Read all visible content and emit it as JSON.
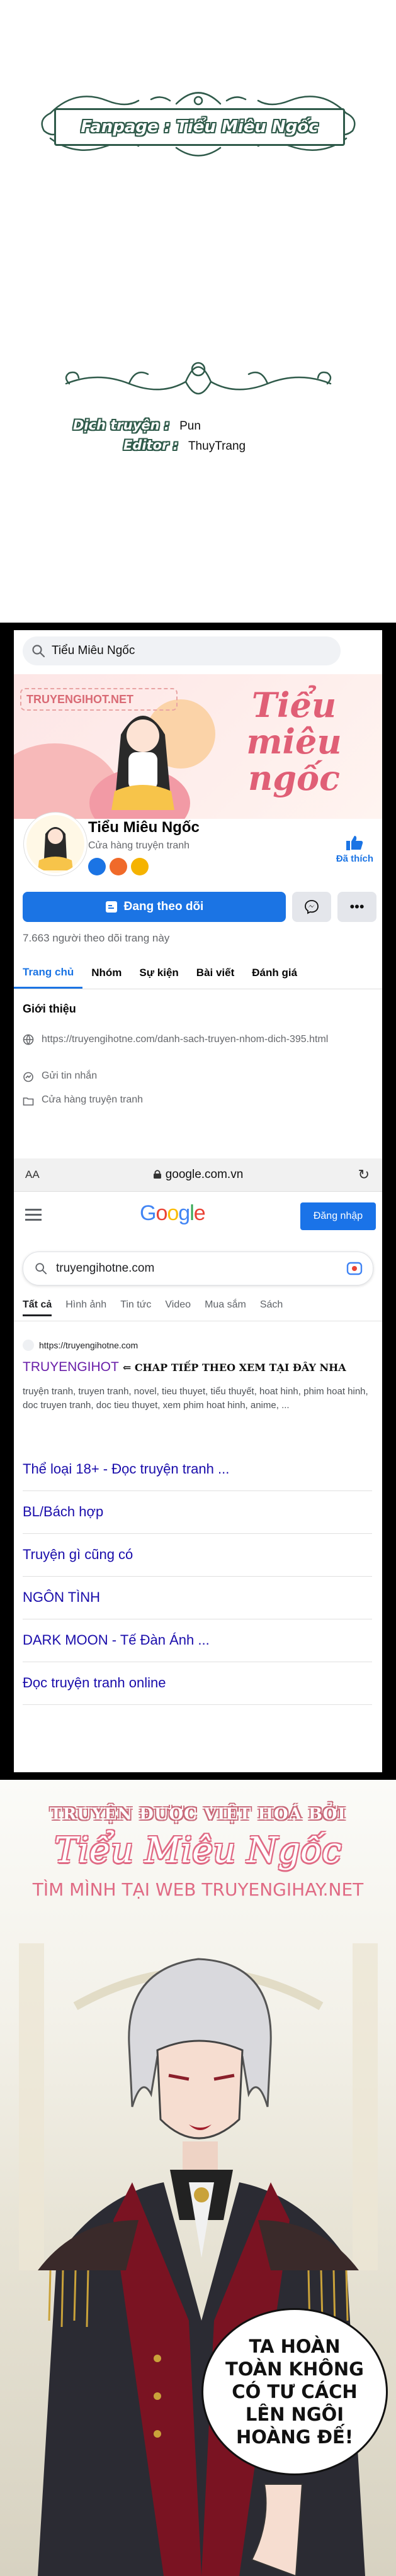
{
  "credits": {
    "fanpage": "Fanpage : Tiểu Miêu Ngốc",
    "translator_label": "Dịch truyện :",
    "translator": "Pun",
    "editor_label": "Editor :",
    "editor": "ThuyTrang"
  },
  "facebook": {
    "search_text": "Tiểu Miêu Ngốc",
    "cover_logo": "TRUYENGIHOT.NET",
    "cover_title": "Tiểu miêu ngốc",
    "page_name": "Tiểu Miêu Ngốc",
    "page_category": "Cửa hàng truyện tranh",
    "like_label": "Đã thích",
    "follow_button": "Đang theo dõi",
    "more_button": "•••",
    "followers": "7.663 người theo dõi trang này",
    "tabs": [
      "Trang chủ",
      "Nhóm",
      "Sự kiện",
      "Bài viết",
      "Đánh giá"
    ],
    "intro_heading": "Giới thiệu",
    "intro_link": "https://truyengihotne.com/danh-sach-truyen-nhom-dich-395.html",
    "message_label": "Gửi tin nhắn",
    "category_label": "Cửa hàng truyện tranh"
  },
  "browser": {
    "aa": "AA",
    "url": "google.com.vn"
  },
  "google": {
    "logo": "Google",
    "signin": "Đăng nhập",
    "query": "truyengihotne.com",
    "tabs": [
      "Tất cả",
      "Hình ảnh",
      "Tin tức",
      "Video",
      "Mua sắm",
      "Sách"
    ],
    "result_url": "https://truyengihotne.com",
    "result_title": "TRUYENGIHOT",
    "result_tag": "⇐ CHAP TIẾP THEO XEM TẠI ĐÂY NHA",
    "result_snippet": "truyện tranh, truyen tranh, novel, tieu thuyet, tiểu thuyết, hoat hinh, phim hoat hinh, doc truyen tranh, doc tieu thuyet, xem phim hoat hinh, anime, ...",
    "links": [
      "Thể loại 18+ - Đọc truyện tranh ...",
      "BL/Bách hợp",
      "Truyện gì cũng có",
      "NGÔN TÌNH",
      "DARK MOON - Tế Đàn Ánh ...",
      "Đọc truyện tranh online"
    ]
  },
  "panel": {
    "watermark_line1": "TRUYỆN ĐƯỢC VIỆT HOÁ BỞI",
    "watermark_line2": "Tiểu Miêu Ngốc",
    "watermark_line3": "TÌM MÌNH TẠI WEB TRUYENGIHAY.NET",
    "speech": "TA HOÀN TOÀN KHÔNG CÓ TƯ CÁCH LÊN NGÔI HOÀNG ĐẾ!"
  },
  "colors": {
    "ornament_green": "#2f5a4a",
    "facebook_blue": "#1b74e4",
    "watermark_pink": "#e06a84"
  }
}
